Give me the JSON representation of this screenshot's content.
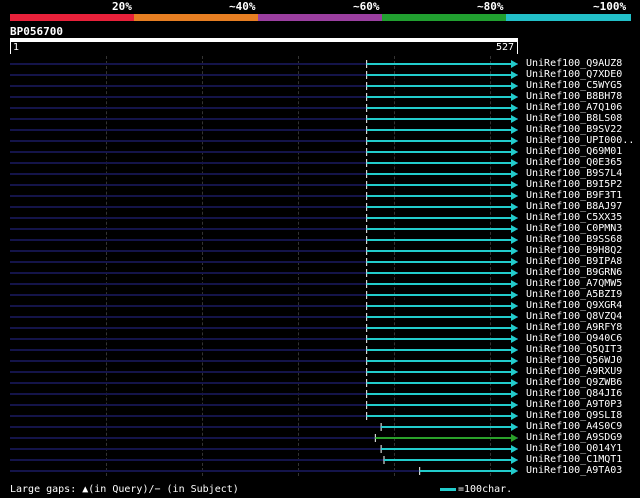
{
  "percent_scale": {
    "labels": [
      "20%",
      "~40%",
      "~60%",
      "~80%",
      "~100%"
    ],
    "colors": [
      "#e8213a",
      "#e67e22",
      "#9b3fa0",
      "#21a030",
      "#22bfc8"
    ]
  },
  "query": {
    "name": "BP056700",
    "start": "1",
    "end": "527"
  },
  "hits": [
    {
      "name": "UniRef100_Q9AUZ8",
      "start": 370,
      "end": 527,
      "color": "#22cccc"
    },
    {
      "name": "UniRef100_Q7XDE0",
      "start": 370,
      "end": 527,
      "color": "#22cccc"
    },
    {
      "name": "UniRef100_C5WYG5",
      "start": 370,
      "end": 527,
      "color": "#22cccc"
    },
    {
      "name": "UniRef100_B8BH78",
      "start": 370,
      "end": 527,
      "color": "#22cccc"
    },
    {
      "name": "UniRef100_A7Q106",
      "start": 370,
      "end": 527,
      "color": "#22cccc"
    },
    {
      "name": "UniRef100_B8LS08",
      "start": 370,
      "end": 527,
      "color": "#22cccc"
    },
    {
      "name": "UniRef100_B9SV22",
      "start": 370,
      "end": 527,
      "color": "#22cccc"
    },
    {
      "name": "UniRef100_UPI000..",
      "start": 370,
      "end": 527,
      "color": "#22cccc"
    },
    {
      "name": "UniRef100_Q69M01",
      "start": 370,
      "end": 527,
      "color": "#22cccc"
    },
    {
      "name": "UniRef100_Q0E365",
      "start": 370,
      "end": 527,
      "color": "#22cccc"
    },
    {
      "name": "UniRef100_B9S7L4",
      "start": 370,
      "end": 527,
      "color": "#22cccc"
    },
    {
      "name": "UniRef100_B9I5P2",
      "start": 370,
      "end": 527,
      "color": "#22cccc"
    },
    {
      "name": "UniRef100_B9F3T1",
      "start": 370,
      "end": 527,
      "color": "#22cccc"
    },
    {
      "name": "UniRef100_B8AJ97",
      "start": 370,
      "end": 527,
      "color": "#22cccc"
    },
    {
      "name": "UniRef100_C5XX35",
      "start": 370,
      "end": 527,
      "color": "#22cccc"
    },
    {
      "name": "UniRef100_C0PMN3",
      "start": 370,
      "end": 527,
      "color": "#22cccc"
    },
    {
      "name": "UniRef100_B9SS68",
      "start": 370,
      "end": 527,
      "color": "#22cccc"
    },
    {
      "name": "UniRef100_B9H8Q2",
      "start": 370,
      "end": 527,
      "color": "#22cccc"
    },
    {
      "name": "UniRef100_B9IPA8",
      "start": 370,
      "end": 527,
      "color": "#22cccc"
    },
    {
      "name": "UniRef100_B9GRN6",
      "start": 370,
      "end": 527,
      "color": "#22cccc"
    },
    {
      "name": "UniRef100_A7QMW5",
      "start": 370,
      "end": 527,
      "color": "#22cccc"
    },
    {
      "name": "UniRef100_A5BZI9",
      "start": 370,
      "end": 527,
      "color": "#22cccc"
    },
    {
      "name": "UniRef100_Q9XGR4",
      "start": 370,
      "end": 527,
      "color": "#22cccc"
    },
    {
      "name": "UniRef100_Q8VZQ4",
      "start": 370,
      "end": 527,
      "color": "#22cccc"
    },
    {
      "name": "UniRef100_A9RFY8",
      "start": 370,
      "end": 527,
      "color": "#22cccc"
    },
    {
      "name": "UniRef100_Q940C6",
      "start": 370,
      "end": 527,
      "color": "#22cccc"
    },
    {
      "name": "UniRef100_Q5QIT3",
      "start": 370,
      "end": 527,
      "color": "#22cccc"
    },
    {
      "name": "UniRef100_Q56WJ0",
      "start": 370,
      "end": 527,
      "color": "#22cccc"
    },
    {
      "name": "UniRef100_A9RXU9",
      "start": 370,
      "end": 527,
      "color": "#22cccc"
    },
    {
      "name": "UniRef100_Q9ZWB6",
      "start": 370,
      "end": 527,
      "color": "#22cccc"
    },
    {
      "name": "UniRef100_Q84JI6",
      "start": 370,
      "end": 527,
      "color": "#22cccc"
    },
    {
      "name": "UniRef100_A9T0P3",
      "start": 370,
      "end": 527,
      "color": "#22cccc"
    },
    {
      "name": "UniRef100_Q9SLI8",
      "start": 370,
      "end": 527,
      "color": "#22cccc"
    },
    {
      "name": "UniRef100_A4S0C9",
      "start": 385,
      "end": 527,
      "color": "#22cccc"
    },
    {
      "name": "UniRef100_A9SDG9",
      "start": 379,
      "end": 527,
      "color": "#2aa12a"
    },
    {
      "name": "UniRef100_Q014Y1",
      "start": 385,
      "end": 527,
      "color": "#22cccc"
    },
    {
      "name": "UniRef100_C1MQT1",
      "start": 388,
      "end": 527,
      "color": "#22cccc"
    },
    {
      "name": "UniRef100_A9TA03",
      "start": 425,
      "end": 527,
      "color": "#22cccc"
    }
  ],
  "legend": {
    "gaps_text": "Large gaps: ▲(in Query)/− (in Subject)",
    "scale_text": "=100char."
  }
}
